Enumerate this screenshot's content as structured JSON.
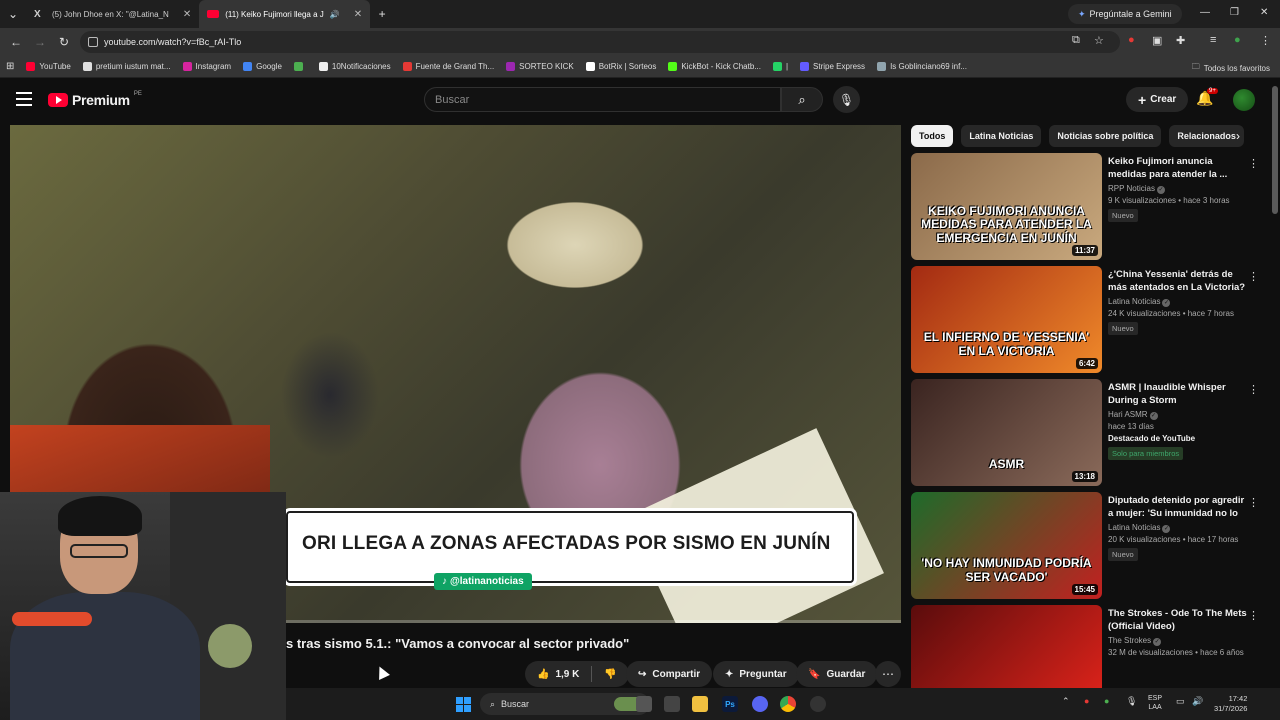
{
  "browser": {
    "tabs": [
      {
        "title": "(5) John Dhoe en X: \"@Latina_N",
        "icon": "x-logo-icon",
        "active": false
      },
      {
        "title": "(11) Keiko Fujimori llega a J",
        "icon": "youtube-icon",
        "active": true
      }
    ],
    "new_tab": "+",
    "gemini_label": "Pregúntale a Gemini",
    "url": "youtube.com/watch?v=fBc_rAI-Tlo",
    "bookmarks": [
      {
        "label": "YouTube",
        "color": "#ff0033"
      },
      {
        "label": "pretium iustum mat...",
        "color": "#e0e0e0"
      },
      {
        "label": "Instagram",
        "color": "#d6249f"
      },
      {
        "label": "Google",
        "color": "#4285f4"
      },
      {
        "label": "",
        "color": "#4caf50"
      },
      {
        "label": "10Notificaciones",
        "color": "#eeeeee"
      },
      {
        "label": "Fuente de Grand Th...",
        "color": "#e53935"
      },
      {
        "label": "SORTEO KICK",
        "color": "#9c27b0"
      },
      {
        "label": "BotRix | Sorteos",
        "color": "#ffffff"
      },
      {
        "label": "KickBot - Kick Chatb...",
        "color": "#53fc18"
      },
      {
        "label": "|",
        "color": "#25d366"
      },
      {
        "label": "Stripe Express",
        "color": "#635bff"
      },
      {
        "label": "Is Goblinciano69 inf...",
        "color": "#90a4ae"
      }
    ],
    "all_bookmarks": "Todos los favoritos"
  },
  "youtube": {
    "logo_text": "Premium",
    "region": "PE",
    "search_placeholder": "Buscar",
    "create_label": "Crear",
    "notif_count": "9+",
    "video": {
      "headline": "ORI LLEGA A ZONAS AFECTADAS POR SISMO EN JUNÍN",
      "handle": "@latinanoticias",
      "caption_title": "s tras sismo 5.1.: \"Vamos a convocar al sector privado\"",
      "likes": "1,9 K",
      "share_label": "Compartir",
      "ask_label": "Preguntar",
      "save_label": "Guardar"
    },
    "chips": [
      "Todos",
      "Latina Noticias",
      "Noticias sobre política",
      "Relacionados"
    ],
    "recommendations": [
      {
        "title": "Keiko Fujimori anuncia medidas para atender la ...",
        "channel": "RPP Noticias",
        "stats": "9 K visualizaciones • hace 3 horas",
        "badge": "Nuevo",
        "duration": "11:37",
        "thumb_text": "KEIKO FUJIMORI ANUNCIA MEDIDAS PARA ATENDER LA EMERGENCIA EN JUNÍN",
        "thumb_colors": [
          "#8b6a4a",
          "#c9a97e"
        ]
      },
      {
        "title": "¿'China Yessenia' detrás de más atentados en La Victoria? ...",
        "channel": "Latina Noticias",
        "stats": "24 K visualizaciones • hace 7 horas",
        "badge": "Nuevo",
        "duration": "6:42",
        "thumb_text": "EL INFIERNO DE 'YESSENIA' EN LA VICTORIA",
        "thumb_colors": [
          "#a32a12",
          "#f08a2a"
        ]
      },
      {
        "title": "ASMR | Inaudible Whisper During a Storm",
        "channel": "Hari ASMR",
        "stats": "hace 13 días",
        "badge_strong": "Destacado de YouTube",
        "badge_member": "Solo para miembros",
        "duration": "13:18",
        "thumb_text": "ASMR",
        "thumb_colors": [
          "#3a2420",
          "#8a6a5a"
        ]
      },
      {
        "title": "Diputado detenido por agredir a mujer: 'Su inmunidad no lo ...",
        "channel": "Latina Noticias",
        "stats": "20 K visualizaciones • hace 17 horas",
        "badge": "Nuevo",
        "duration": "15:45",
        "thumb_text": "'NO HAY INMUNIDAD PODRÍA SER VACADO'",
        "thumb_colors": [
          "#1d6b2a",
          "#c32020"
        ]
      },
      {
        "title": "The Strokes - Ode To The Mets (Official Video)",
        "channel": "The Strokes",
        "stats": "32 M de visualizaciones • hace 6 años",
        "duration": "",
        "thumb_text": "",
        "thumb_colors": [
          "#5a0c0c",
          "#e3241b"
        ]
      }
    ]
  },
  "taskbar": {
    "search_placeholder": "Buscar",
    "lang_top": "ESP",
    "lang_bottom": "LAA",
    "time": "17:42",
    "date": "31/7/2026"
  }
}
